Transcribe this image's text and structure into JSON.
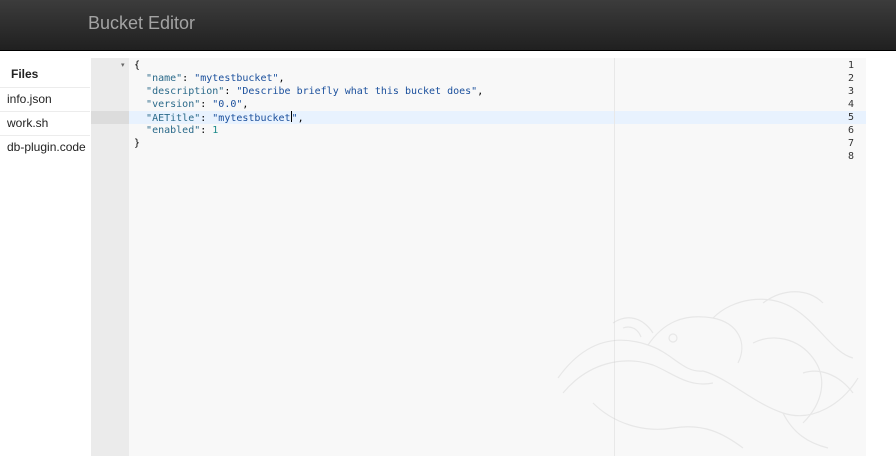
{
  "app": {
    "title": "Bucket Editor"
  },
  "sidebar": {
    "heading": "Files",
    "files": [
      {
        "label": "info.json"
      },
      {
        "label": "work.sh"
      },
      {
        "label": "db-plugin.code"
      }
    ]
  },
  "editor": {
    "active_line": 5,
    "lines": [
      {
        "num": "1",
        "fold": "▾",
        "text": "{"
      },
      {
        "num": "2",
        "key": "\"name\"",
        "value": "\"mytestbucket\"",
        "trail": ","
      },
      {
        "num": "3",
        "key": "\"description\"",
        "value": "\"Describe briefly what this bucket does\"",
        "trail": ","
      },
      {
        "num": "4",
        "key": "\"version\"",
        "value": "\"0.0\"",
        "trail": ","
      },
      {
        "num": "5",
        "key": "\"AETitle\"",
        "value_a": "\"mytestbucket",
        "value_b": "\"",
        "trail": ","
      },
      {
        "num": "6",
        "key": "\"enabled\"",
        "value": "1",
        "trail": ""
      },
      {
        "num": "7",
        "text": "}"
      },
      {
        "num": "8",
        "text": ""
      }
    ]
  }
}
